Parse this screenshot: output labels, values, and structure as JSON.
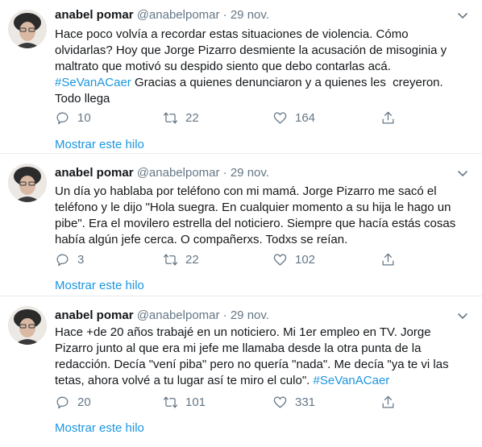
{
  "tweets": [
    {
      "name": "anabel pomar",
      "handle": "@anabelpomar",
      "separator": "·",
      "date": "29 nov.",
      "text_lines": [
        "Hace poco volvía a recordar estas situaciones de violencia. Cómo",
        "olvidarlas? Hoy que Jorge Pizarro desmiente la acusación de misoginia y",
        "maltrato que motivó su despido siento que debo contarlas acá.",
        "Gracias a quienes denunciaron y a quienes les  creyeron.",
        "Todo llega"
      ],
      "hashtag": "#SeVanACaer",
      "replies": "10",
      "retweets": "22",
      "likes": "164",
      "show_thread": "Mostrar este hilo"
    },
    {
      "name": "anabel pomar",
      "handle": "@anabelpomar",
      "separator": "·",
      "date": "29 nov.",
      "text_lines": [
        "Un día yo hablaba por teléfono con mi mamá. Jorge Pizarro me sacó el",
        "teléfono y le dijo \"Hola suegra. En cualquier momento a su hija le hago un",
        "pibe\". Era el movilero estrella del noticiero. Siempre que hacía estás cosas",
        "había algún jefe cerca. O compañerxs. Todxs se reían."
      ],
      "replies": "3",
      "retweets": "22",
      "likes": "102",
      "show_thread": "Mostrar este hilo"
    },
    {
      "name": "anabel pomar",
      "handle": "@anabelpomar",
      "separator": "·",
      "date": "29 nov.",
      "text_lines": [
        "Hace +de 20 años trabajé en un noticiero. Mi 1er empleo en TV. Jorge",
        "Pizarro junto al que era mi jefe me llamaba desde la otra punta de la",
        "redacción. Decía \"vení piba\" pero no quería \"nada\". Me decía \"ya te vi las",
        "tetas, ahora volvé a tu lugar así te miro el culo\"."
      ],
      "hashtag": "#SeVanACaer",
      "replies": "20",
      "retweets": "101",
      "likes": "331",
      "show_thread": "Mostrar este hilo"
    }
  ]
}
